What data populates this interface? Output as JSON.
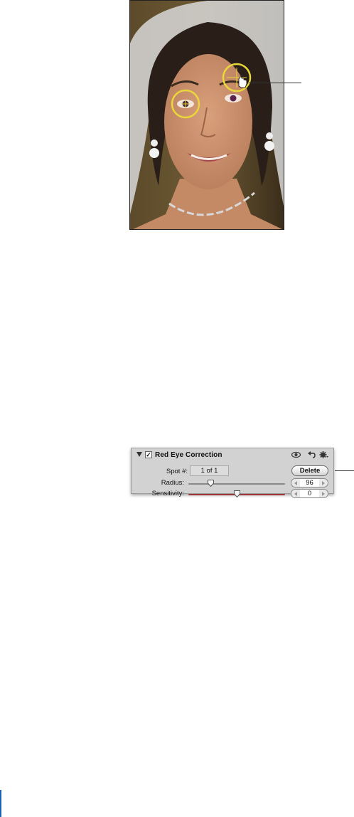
{
  "panel": {
    "title": "Red Eye Correction",
    "checkbox_mark": "✓",
    "spot_label": "Spot #:",
    "spot_value": "1 of 1",
    "delete_label": "Delete",
    "radius_label": "Radius:",
    "radius_value": "96",
    "radius_level": 0.23,
    "sensitivity_label": "Sensitivity:",
    "sensitivity_value": "0",
    "sensitivity_level": 0.5
  },
  "icons": {
    "header": [
      "eye-icon",
      "reset-icon",
      "gear-icon"
    ]
  },
  "colors": {
    "spot_circle": "#e8d63a",
    "panel_bg": "#d2d2d2",
    "sensitivity_track": "#a03636"
  }
}
